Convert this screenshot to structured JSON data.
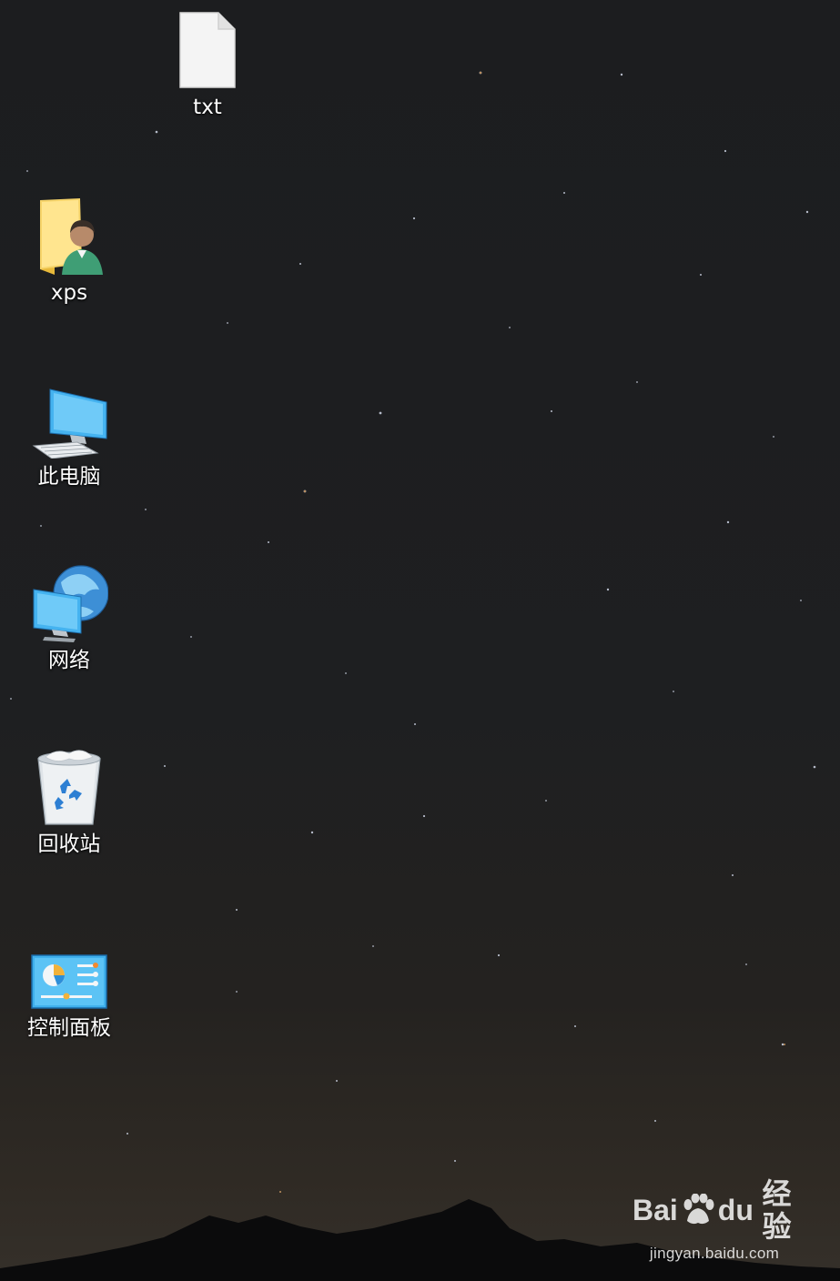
{
  "desktop": {
    "icons": [
      {
        "label": "txt",
        "icon": "text-file-icon"
      },
      {
        "label": "xps",
        "icon": "user-folder-icon"
      },
      {
        "label": "此电脑",
        "icon": "this-pc-icon"
      },
      {
        "label": "网络",
        "icon": "network-icon"
      },
      {
        "label": "回收站",
        "icon": "recycle-bin-icon"
      },
      {
        "label": "控制面板",
        "icon": "control-panel-icon"
      }
    ]
  },
  "watermark": {
    "brand_left": "Bai",
    "brand_mid": "du",
    "brand_right": "经验",
    "url": "jingyan.baidu.com"
  },
  "colors": {
    "sky": "#1e1f21",
    "label_text": "#ffffff",
    "folder": "#f2c94c",
    "monitor": "#3aa7ea"
  }
}
